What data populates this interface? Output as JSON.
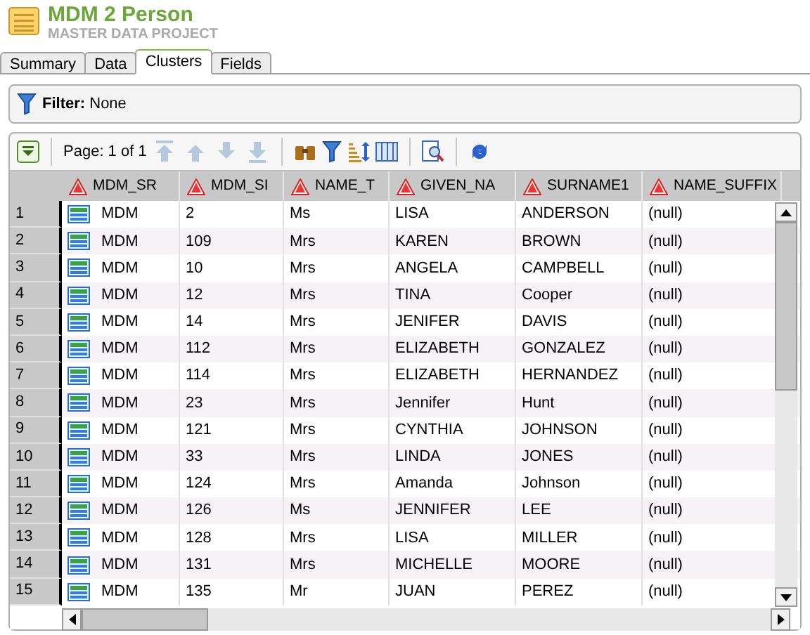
{
  "header": {
    "title": "MDM 2 Person",
    "subtitle": "MASTER DATA PROJECT"
  },
  "tabs": [
    {
      "label": "Summary",
      "selected": false
    },
    {
      "label": "Data",
      "selected": false
    },
    {
      "label": "Clusters",
      "selected": true
    },
    {
      "label": "Fields",
      "selected": false
    }
  ],
  "filter": {
    "label": "Filter:",
    "value": "None"
  },
  "toolbar": {
    "page": "Page: 1 of 1",
    "nav": [
      {
        "kind": "first",
        "disabled": true
      },
      {
        "kind": "up",
        "disabled": true
      },
      {
        "kind": "down",
        "disabled": true
      },
      {
        "kind": "last",
        "disabled": true
      }
    ]
  },
  "table": {
    "columns": [
      "MDM_SR",
      "MDM_SI",
      "NAME_T",
      "GIVEN_NA",
      "SURNAME1",
      "NAME_SUFFIX"
    ],
    "rows": [
      {
        "n": "1",
        "cells": [
          "MDM",
          "2",
          "Ms",
          "LISA",
          "ANDERSON",
          "(null)"
        ]
      },
      {
        "n": "2",
        "cells": [
          "MDM",
          "109",
          "Mrs",
          "KAREN",
          "BROWN",
          "(null)"
        ]
      },
      {
        "n": "3",
        "cells": [
          "MDM",
          "10",
          "Mrs",
          "ANGELA",
          "CAMPBELL",
          "(null)"
        ]
      },
      {
        "n": "4",
        "cells": [
          "MDM",
          "12",
          "Mrs",
          "TINA",
          "Cooper",
          "(null)"
        ]
      },
      {
        "n": "5",
        "cells": [
          "MDM",
          "14",
          "Mrs",
          "JENIFER",
          "DAVIS",
          "(null)"
        ]
      },
      {
        "n": "6",
        "cells": [
          "MDM",
          "112",
          "Mrs",
          "ELIZABETH",
          "GONZALEZ",
          "(null)"
        ]
      },
      {
        "n": "7",
        "cells": [
          "MDM",
          "114",
          "Mrs",
          "ELIZABETH",
          "HERNANDEZ",
          "(null)"
        ]
      },
      {
        "n": "8",
        "cells": [
          "MDM",
          "23",
          "Mrs",
          "Jennifer",
          "Hunt",
          "(null)"
        ]
      },
      {
        "n": "9",
        "cells": [
          "MDM",
          "121",
          "Mrs",
          "CYNTHIA",
          "JOHNSON",
          "(null)"
        ]
      },
      {
        "n": "10",
        "cells": [
          "MDM",
          "33",
          "Mrs",
          "LINDA",
          "JONES",
          "(null)"
        ]
      },
      {
        "n": "11",
        "cells": [
          "MDM",
          "124",
          "Mrs",
          "Amanda",
          "Johnson",
          "(null)"
        ]
      },
      {
        "n": "12",
        "cells": [
          "MDM",
          "126",
          "Ms",
          "JENNIFER",
          "LEE",
          "(null)"
        ]
      },
      {
        "n": "13",
        "cells": [
          "MDM",
          "128",
          "Mrs",
          "LISA",
          "MILLER",
          "(null)"
        ]
      },
      {
        "n": "14",
        "cells": [
          "MDM",
          "131",
          "Mrs",
          "MICHELLE",
          "MOORE",
          "(null)"
        ]
      },
      {
        "n": "15",
        "cells": [
          "MDM",
          "135",
          "Mr",
          "JUAN",
          "PEREZ",
          "(null)"
        ]
      }
    ]
  }
}
